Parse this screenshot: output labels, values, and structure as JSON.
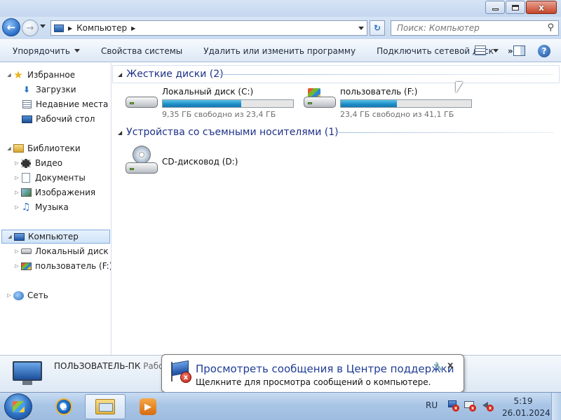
{
  "window": {
    "minimize_label": "",
    "maximize_label": "",
    "close_label": "x"
  },
  "address_bar": {
    "breadcrumb": [
      "Компьютер"
    ],
    "search_placeholder": "Поиск: Компьютер"
  },
  "command_bar": {
    "items": [
      {
        "label": "Упорядочить",
        "dropdown": true
      },
      {
        "label": "Свойства системы"
      },
      {
        "label": "Удалить или изменить программу"
      },
      {
        "label": "Подключить сетевой диск"
      }
    ],
    "more_label": "»",
    "help_label": "?"
  },
  "nav_pane": {
    "favorites": {
      "label": "Избранное",
      "items": [
        "Загрузки",
        "Недавние места",
        "Рабочий стол"
      ]
    },
    "libraries": {
      "label": "Библиотеки",
      "items": [
        "Видео",
        "Документы",
        "Изображения",
        "Музыка"
      ]
    },
    "computer": {
      "label": "Компьютер",
      "items": [
        "Локальный диск (C",
        "пользователь (F:)"
      ]
    },
    "network": {
      "label": "Сеть"
    }
  },
  "content": {
    "groups": [
      {
        "title": "Жесткие диски (2)",
        "drives": [
          {
            "name": "Локальный диск (C:)",
            "free_text": "9,35 ГБ свободно из 23,4 ГБ",
            "used_fraction": 0.6,
            "icon": "hard-drive-icon"
          },
          {
            "name": "пользователь (F:)",
            "free_text": "23,4 ГБ свободно из 41,1 ГБ",
            "used_fraction": 0.43,
            "icon": "windows-drive-icon"
          }
        ]
      },
      {
        "title": "Устройства со съемными носителями (1)",
        "drives": [
          {
            "name": "CD-дисковод (D:)",
            "icon": "cd-drive-icon"
          }
        ]
      }
    ]
  },
  "details_pane": {
    "computer_name": "ПОЛЬЗОВАТЕЛЬ-ПК",
    "computer_name_rest": "Рабо"
  },
  "notification": {
    "title": "Просмотреть сообщения в Центре поддержки",
    "text": "Щелкните для просмотра сообщений о компьютере.",
    "close_label": "x"
  },
  "taskbar": {
    "language": "RU",
    "time": "5:19",
    "date": "26.01.2024"
  },
  "colors": {
    "accent": "#1e3287",
    "progress": "#1e8fc7",
    "link_blue": "#1e3c95"
  }
}
